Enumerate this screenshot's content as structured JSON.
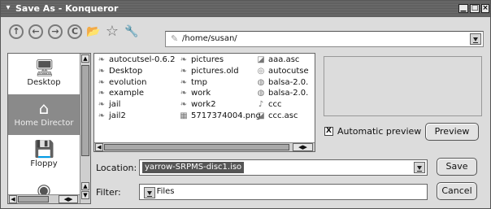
{
  "window": {
    "title": "Save As - Konqueror",
    "menu_glyph": "▾",
    "controls": [
      "▁",
      "□",
      "×"
    ]
  },
  "toolbar": {
    "icons": [
      {
        "name": "up-icon",
        "glyph": "↑"
      },
      {
        "name": "back-icon",
        "glyph": "←"
      },
      {
        "name": "forward-icon",
        "glyph": "→"
      },
      {
        "name": "reload-icon",
        "glyph": "C"
      },
      {
        "name": "new-folder-icon",
        "glyph": "📂"
      },
      {
        "name": "bookmark-icon",
        "glyph": "☆"
      },
      {
        "name": "configure-icon",
        "glyph": "🔧"
      }
    ],
    "path": "/home/susan/",
    "path_icon": "✎"
  },
  "sidebar": {
    "items": [
      {
        "label": "Desktop",
        "icon": "desktop-icon",
        "glyph": "🖥"
      },
      {
        "label": "Home Director",
        "icon": "home-icon",
        "glyph": "⌂",
        "active": true
      },
      {
        "label": "Floppy",
        "icon": "floppy-icon",
        "glyph": "💾"
      },
      {
        "label": "",
        "icon": "cdrom-icon",
        "glyph": "◉"
      }
    ],
    "scroll_up": "▲",
    "scroll_down": "▼"
  },
  "files": {
    "columns": [
      [
        {
          "name": "autocutsel-0.6.2",
          "icon": "folder-icon",
          "glyph": "❧"
        },
        {
          "name": "Desktop",
          "icon": "folder-icon",
          "glyph": "❧"
        },
        {
          "name": "evolution",
          "icon": "folder-icon",
          "glyph": "❧"
        },
        {
          "name": "example",
          "icon": "folder-icon",
          "glyph": "❧"
        },
        {
          "name": "jail",
          "icon": "folder-icon",
          "glyph": "❧"
        },
        {
          "name": "jail2",
          "icon": "folder-icon",
          "glyph": "❧"
        }
      ],
      [
        {
          "name": "pictures",
          "icon": "folder-icon",
          "glyph": "❧"
        },
        {
          "name": "pictures.old",
          "icon": "folder-icon",
          "glyph": "❧"
        },
        {
          "name": "tmp",
          "icon": "folder-icon",
          "glyph": "❧"
        },
        {
          "name": "work",
          "icon": "folder-icon",
          "glyph": "❧"
        },
        {
          "name": "work2",
          "icon": "folder-icon",
          "glyph": "❧"
        },
        {
          "name": "5717374004.png",
          "icon": "image-file-icon",
          "glyph": "▦"
        }
      ],
      [
        {
          "name": "aaa.asc",
          "icon": "text-file-icon",
          "glyph": "◪"
        },
        {
          "name": "autocutse",
          "icon": "archive-file-icon",
          "glyph": "◎"
        },
        {
          "name": "balsa-2.0.",
          "icon": "package-file-icon",
          "glyph": "◍"
        },
        {
          "name": "balsa-2.0.",
          "icon": "package-file-icon",
          "glyph": "◍"
        },
        {
          "name": "ccc",
          "icon": "script-file-icon",
          "glyph": "♪"
        },
        {
          "name": "ccc.asc",
          "icon": "text-file-icon",
          "glyph": "◪"
        }
      ]
    ]
  },
  "preview": {
    "checkbox_label": "Automatic preview",
    "checkbox_mark": "X",
    "checked": true,
    "button": "Preview"
  },
  "location": {
    "label": "Location:",
    "value": "yarrow-SRPMS-disc1.iso"
  },
  "filter": {
    "label": "Filter:",
    "value": "All Files"
  },
  "buttons": {
    "save": "Save",
    "cancel": "Cancel"
  }
}
